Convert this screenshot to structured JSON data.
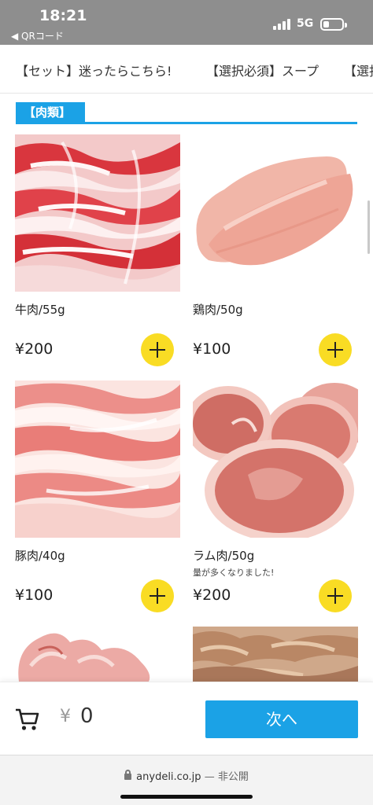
{
  "status_bar": {
    "time": "18:21",
    "back_label": "◀ QRコード",
    "network": "5G",
    "battery_level": 0.3
  },
  "tabs": [
    "【セット】迷ったらこちら!",
    "【選択必須】スープ",
    "【選択"
  ],
  "section": {
    "title": "【肉類】"
  },
  "products": [
    {
      "name": "牛肉/55g",
      "note": "",
      "price": "¥200",
      "image": "sliced-beef-photo",
      "add_icon": "plus-icon"
    },
    {
      "name": "鶏肉/50g",
      "note": "",
      "price": "¥100",
      "image": "chicken-breast-photo",
      "add_icon": "plus-icon"
    },
    {
      "name": "豚肉/40g",
      "note": "",
      "price": "¥100",
      "image": "sliced-pork-photo",
      "add_icon": "plus-icon"
    },
    {
      "name": "ラム肉/50g",
      "note": "量が多くなりました!",
      "price": "¥200",
      "image": "lamb-slices-photo",
      "add_icon": "plus-icon"
    },
    {
      "name": "",
      "note": "",
      "price": "",
      "image": "pork-chunks-photo"
    },
    {
      "name": "",
      "note": "",
      "price": "",
      "image": "offal-photo"
    }
  ],
  "cart": {
    "icon": "cart-icon",
    "currency": "¥",
    "count": "0",
    "next_label": "次へ"
  },
  "url_bar": {
    "domain": "anydeli.co.jp",
    "privacy": "— 非公開"
  },
  "colors": {
    "accent": "#1ba2e6",
    "add_button": "#f9dc24",
    "status_bar": "#8e8e8e"
  }
}
